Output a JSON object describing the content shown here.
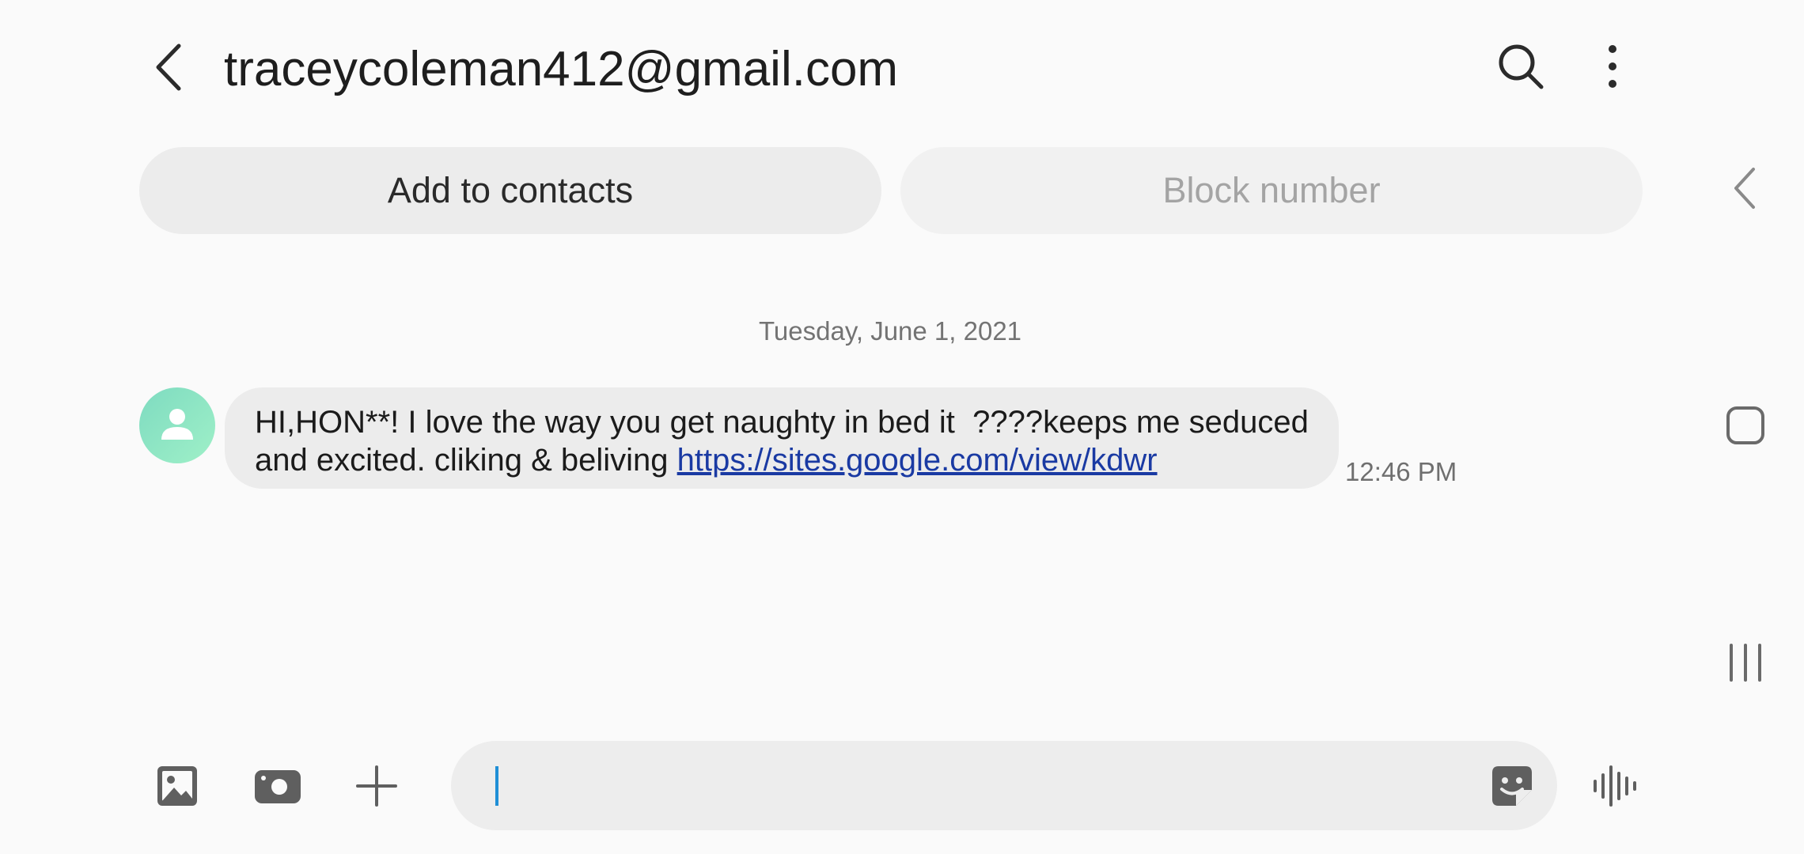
{
  "header": {
    "title": "traceycoleman412@gmail.com",
    "icons": {
      "back": "back-arrow-icon",
      "search": "search-icon",
      "more": "more-options-icon"
    }
  },
  "actions": {
    "add_contacts": "Add to contacts",
    "block_number": "Block number"
  },
  "conversation": {
    "date": "Tuesday, June 1, 2021",
    "messages": [
      {
        "direction": "incoming",
        "line1": "HI,HON**! I love the way you get naughty in bed it  ????keeps me seduced",
        "line2_text": "and excited. cliking & beliving ",
        "link": "https://sites.google.com/view/kdwr",
        "time": "12:46 PM"
      }
    ]
  },
  "composer": {
    "value": "",
    "icons": [
      "gallery-icon",
      "camera-icon",
      "plus-icon",
      "sticker-icon",
      "voice-icon"
    ]
  },
  "colors": {
    "background": "#fafafa",
    "bubble": "#ececec",
    "link": "#1a3aa3",
    "caret": "#1f8fd6",
    "avatar": "#8ee6c4"
  }
}
